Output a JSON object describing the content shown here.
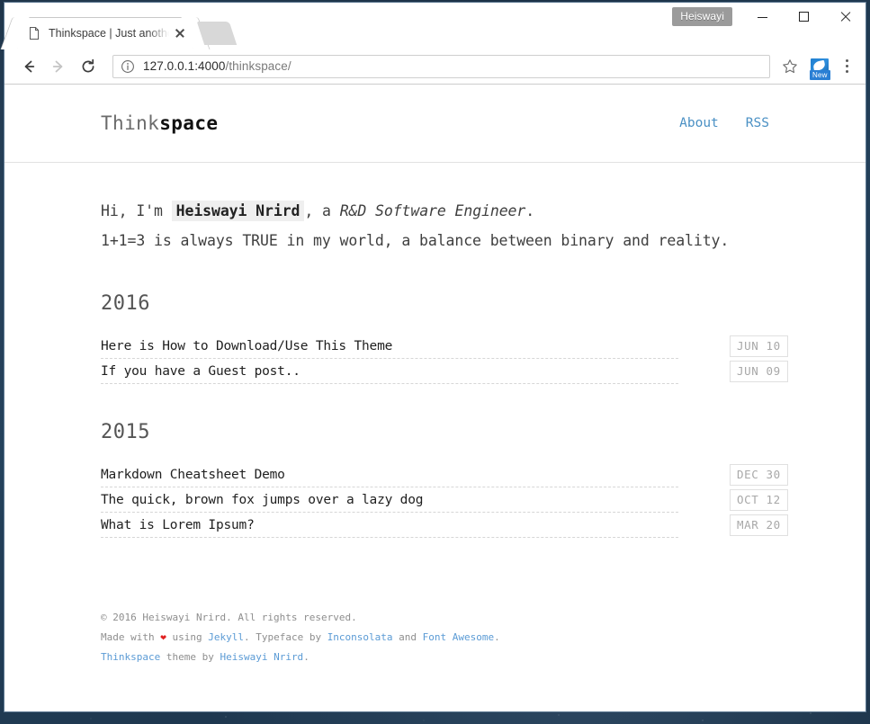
{
  "browser": {
    "tab": {
      "title": "Thinkspace | Just another",
      "favicon_icon": "page-icon",
      "close_icon": "close-icon"
    },
    "new_tab_label": "",
    "profile_chip": "Heiswayi",
    "window_controls": {
      "minimize_icon": "minimize-icon",
      "maximize_icon": "maximize-icon",
      "close_icon": "close-icon"
    },
    "toolbar": {
      "back_icon": "back-arrow-icon",
      "forward_icon": "forward-arrow-icon",
      "reload_icon": "reload-icon",
      "info_icon": "info-circle-icon",
      "url_host": "127.0.0.1:4000",
      "url_path": "/thinkspace/",
      "url_full": "127.0.0.1:4000/thinkspace/",
      "bookmark_icon": "star-icon",
      "extension_icon": "extension-icon",
      "extension_badge": "New",
      "menu_icon": "three-dot-menu-icon"
    }
  },
  "site": {
    "brand_light": "Think",
    "brand_bold": "space",
    "nav": [
      {
        "label": "About"
      },
      {
        "label": "RSS"
      }
    ],
    "intro": {
      "part1": "Hi, I'm ",
      "name": "Heiswayi Nrird",
      "part2": ", a ",
      "role": "R&D Software Engineer",
      "part3": ".",
      "line2": "1+1=3 is always TRUE in my world, a balance between binary and reality."
    },
    "archives": [
      {
        "year": "2016",
        "posts": [
          {
            "title": "Here is How to Download/Use This Theme",
            "date": "JUN 10"
          },
          {
            "title": "If you have a Guest post..",
            "date": "JUN 09"
          }
        ]
      },
      {
        "year": "2015",
        "posts": [
          {
            "title": "Markdown Cheatsheet Demo",
            "date": "DEC 30"
          },
          {
            "title": "The quick, brown fox jumps over a lazy dog",
            "date": "OCT 12"
          },
          {
            "title": "What is Lorem Ipsum?",
            "date": "MAR 20"
          }
        ]
      }
    ],
    "footer": {
      "copyright": "© 2016 Heiswayi Nrird. All rights reserved.",
      "made_with": "Made with ",
      "heart": "❤",
      "using": " using ",
      "jekyll": "Jekyll",
      "typeface_by": ". Typeface by ",
      "inconsolata": "Inconsolata",
      "and": " and ",
      "font_awesome": "Font Awesome",
      "period": ".",
      "theme_name": "Thinkspace",
      "theme_by": " theme by ",
      "author": "Heiswayi Nrird",
      "end": "."
    }
  }
}
